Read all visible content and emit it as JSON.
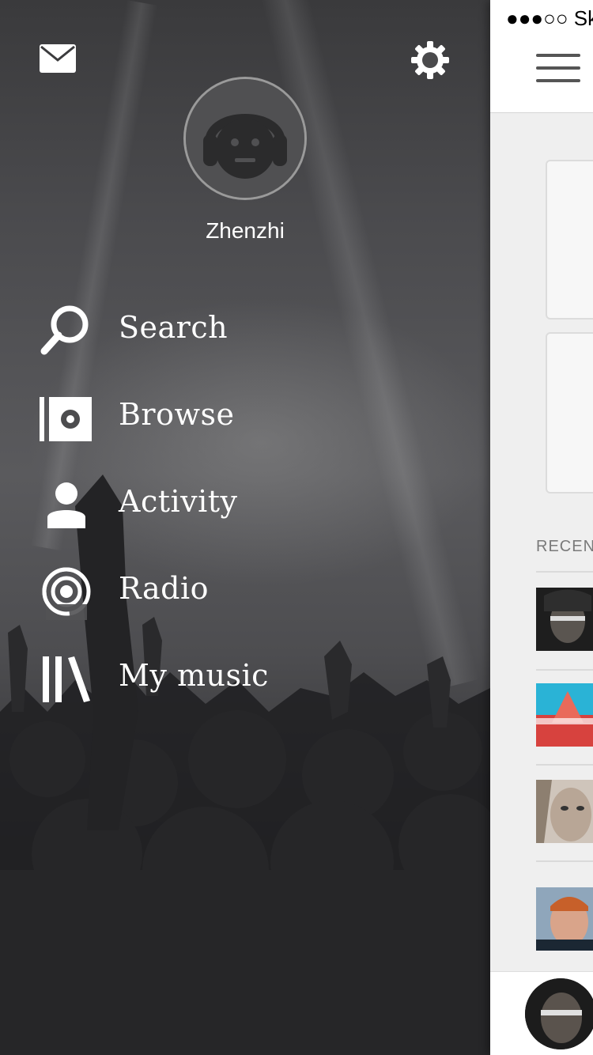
{
  "drawer": {
    "username": "Zhenzhi",
    "top_icons": [
      "mail-icon",
      "gear-icon"
    ],
    "menu": [
      {
        "label": "Search",
        "icon": "search-icon"
      },
      {
        "label": "Browse",
        "icon": "browse-icon"
      },
      {
        "label": "Activity",
        "icon": "person-icon"
      },
      {
        "label": "Radio",
        "icon": "radio-icon"
      },
      {
        "label": "My music",
        "icon": "library-icon"
      }
    ]
  },
  "main": {
    "status_bar": {
      "text": "●●●○○ Sk"
    },
    "section_title": "RECENT",
    "menu_icon": "hamburger-icon"
  },
  "colors": {
    "drawer_text": "#ffffff",
    "main_background": "#efefef"
  }
}
